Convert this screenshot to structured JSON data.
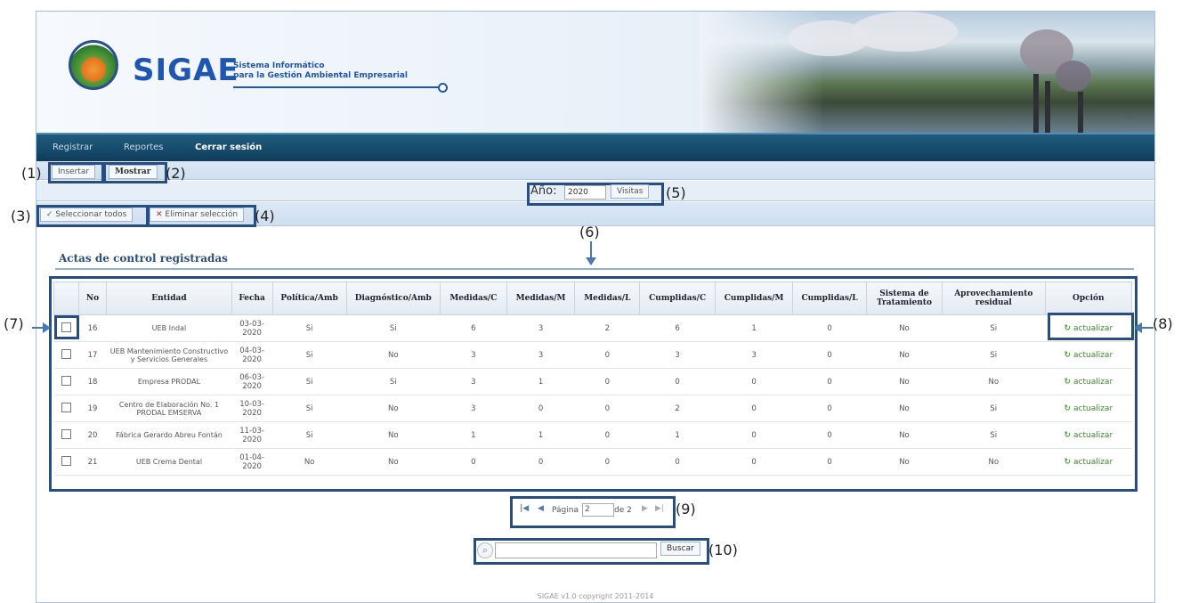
{
  "app": {
    "logo_text": "SIGAE",
    "logo_sub_line1": "Sistema Informático",
    "logo_sub_line2": "para la Gestión Ambiental Empresarial"
  },
  "nav": {
    "items": [
      "Registrar",
      "Reportes",
      "Cerrar sesión"
    ]
  },
  "toolbar": {
    "insert_label": "Insertar",
    "show_label": "Mostrar",
    "year_label": "Año:",
    "year_value": "2020",
    "visits_label": "Visitas",
    "select_all_label": "Seleccionar todos",
    "delete_selection_label": "Eliminar selección"
  },
  "section": {
    "title": "Actas de control registradas"
  },
  "table": {
    "columns": [
      "No",
      "Entidad",
      "Fecha",
      "Política/Amb",
      "Diagnóstico/Amb",
      "Medidas/C",
      "Medidas/M",
      "Medidas/L",
      "Cumplidas/C",
      "Cumplidas/M",
      "Cumplidas/L",
      "Sistema de Tratamiento",
      "Aprovechamiento residual",
      "Opción"
    ],
    "rows": [
      {
        "no": "16",
        "entidad": "UEB Indal",
        "fecha": "03-03-2020",
        "politica": "Si",
        "diagnostico": "Si",
        "med_c": "6",
        "med_m": "3",
        "med_l": "2",
        "cum_c": "6",
        "cum_m": "1",
        "cum_l": "0",
        "sistema": "No",
        "aprovechamiento": "Si",
        "opcion": "actualizar"
      },
      {
        "no": "17",
        "entidad": "UEB Mantenimiento Constructivo y Servicios Generales",
        "fecha": "04-03-2020",
        "politica": "Si",
        "diagnostico": "No",
        "med_c": "3",
        "med_m": "3",
        "med_l": "0",
        "cum_c": "3",
        "cum_m": "3",
        "cum_l": "0",
        "sistema": "No",
        "aprovechamiento": "Si",
        "opcion": "actualizar"
      },
      {
        "no": "18",
        "entidad": "Empresa PRODAL",
        "fecha": "06-03-2020",
        "politica": "Si",
        "diagnostico": "Si",
        "med_c": "3",
        "med_m": "1",
        "med_l": "0",
        "cum_c": "0",
        "cum_m": "0",
        "cum_l": "0",
        "sistema": "No",
        "aprovechamiento": "No",
        "opcion": "actualizar"
      },
      {
        "no": "19",
        "entidad": "Centro de Elaboración No. 1 PRODAL EMSERVA",
        "fecha": "10-03-2020",
        "politica": "Si",
        "diagnostico": "No",
        "med_c": "3",
        "med_m": "0",
        "med_l": "0",
        "cum_c": "2",
        "cum_m": "0",
        "cum_l": "0",
        "sistema": "No",
        "aprovechamiento": "Si",
        "opcion": "actualizar"
      },
      {
        "no": "20",
        "entidad": "Fábrica Gerardo Abreu Fontán",
        "fecha": "11-03-2020",
        "politica": "Si",
        "diagnostico": "No",
        "med_c": "1",
        "med_m": "1",
        "med_l": "0",
        "cum_c": "1",
        "cum_m": "0",
        "cum_l": "0",
        "sistema": "No",
        "aprovechamiento": "Si",
        "opcion": "actualizar"
      },
      {
        "no": "21",
        "entidad": "UEB Crema Dental",
        "fecha": "01-04-2020",
        "politica": "No",
        "diagnostico": "No",
        "med_c": "0",
        "med_m": "0",
        "med_l": "0",
        "cum_c": "0",
        "cum_m": "0",
        "cum_l": "0",
        "sistema": "No",
        "aprovechamiento": "No",
        "opcion": "actualizar"
      }
    ]
  },
  "pager": {
    "page_label": "Página",
    "page_value": "2",
    "of_label": "de 2"
  },
  "search": {
    "button_label": "Buscar",
    "value": ""
  },
  "footer": {
    "text": "SIGAE v1.0 copyright 2011-2014"
  },
  "callouts": {
    "c1": "(1)",
    "c2": "(2)",
    "c3": "(3)",
    "c4": "(4)",
    "c5": "(5)",
    "c6": "(6)",
    "c7": "(7)",
    "c8": "(8)",
    "c9": "(9)",
    "c10": "(10)"
  },
  "colors": {
    "nav_bg": "#164a6b",
    "brand_blue": "#1f56b2",
    "highlight_border": "#264e84",
    "action_green": "#3a8a2c"
  },
  "icons": [
    "check-all-icon",
    "delete-x-icon",
    "refresh-icon",
    "first-page-icon",
    "prev-page-icon",
    "next-page-icon",
    "last-page-icon",
    "search-icon"
  ]
}
